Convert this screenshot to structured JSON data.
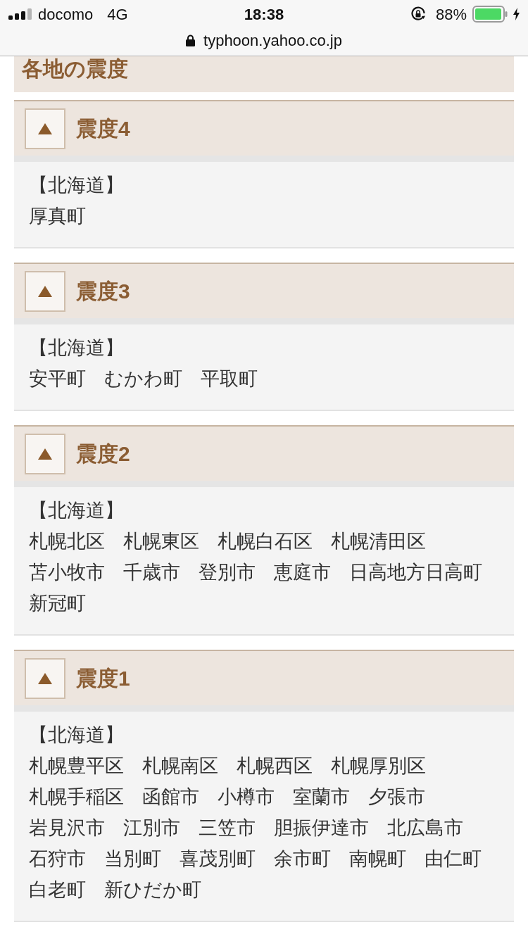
{
  "status_bar": {
    "carrier": "docomo",
    "network": "4G",
    "time": "18:38",
    "battery_percent": "88%"
  },
  "address_bar": {
    "url": "typhoon.yahoo.co.jp"
  },
  "page_title": "各地の震度",
  "sections": [
    {
      "title": "震度4",
      "expanded": true,
      "region": "【北海道】",
      "places": [
        "厚真町"
      ]
    },
    {
      "title": "震度3",
      "expanded": true,
      "region": "【北海道】",
      "places": [
        "安平町",
        "むかわ町",
        "平取町"
      ]
    },
    {
      "title": "震度2",
      "expanded": true,
      "region": "【北海道】",
      "places": [
        "札幌北区",
        "札幌東区",
        "札幌白石区",
        "札幌清田区",
        "苫小牧市",
        "千歳市",
        "登別市",
        "恵庭市",
        "日高地方日高町",
        "新冠町"
      ]
    },
    {
      "title": "震度1",
      "expanded": true,
      "region": "【北海道】",
      "places": [
        "札幌豊平区",
        "札幌南区",
        "札幌西区",
        "札幌厚別区",
        "札幌手稲区",
        "函館市",
        "小樽市",
        "室蘭市",
        "夕張市",
        "岩見沢市",
        "江別市",
        "三笠市",
        "胆振伊達市",
        "北広島市",
        "石狩市",
        "当別町",
        "喜茂別町",
        "余市町",
        "南幌町",
        "由仁町",
        "白老町",
        "新ひだか町"
      ]
    }
  ]
}
